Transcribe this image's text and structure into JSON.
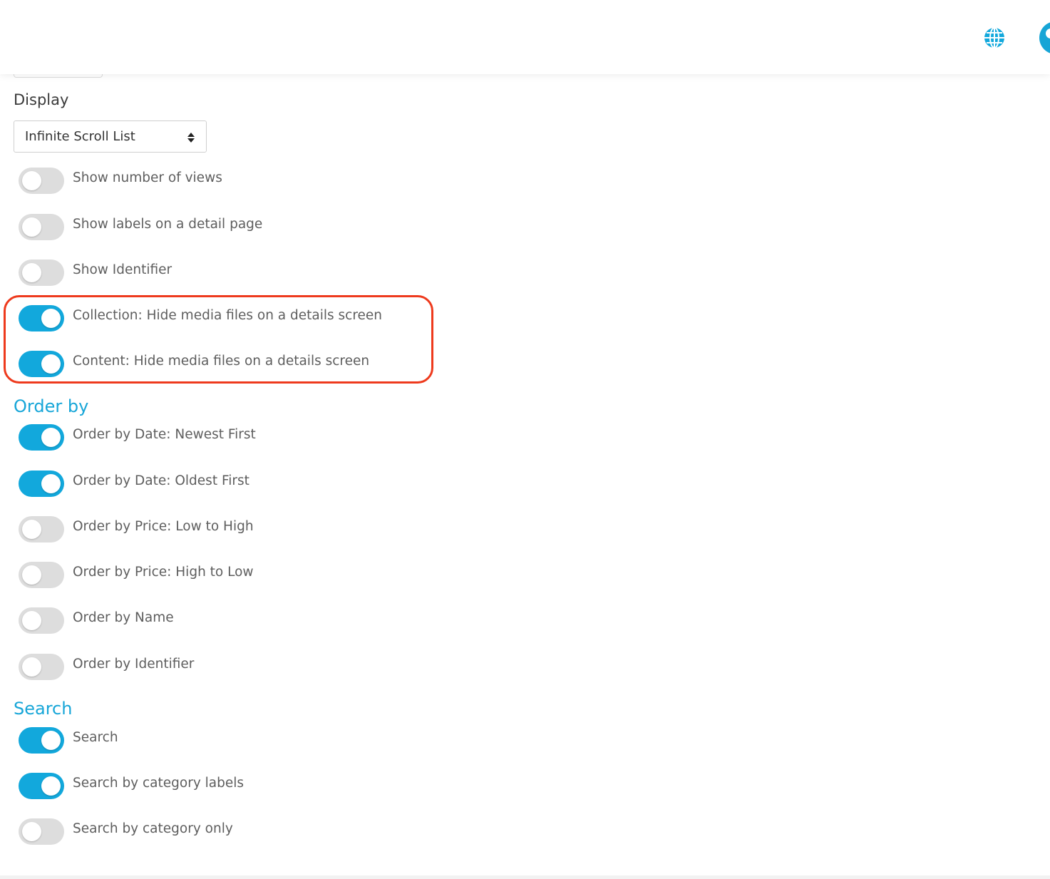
{
  "display": {
    "label": "Display",
    "select_value": "Infinite Scroll List"
  },
  "display_toggles": [
    {
      "label": "Show number of views",
      "on": false
    },
    {
      "label": "Show labels on a detail page",
      "on": false
    },
    {
      "label": "Show Identifier",
      "on": false
    },
    {
      "label": "Collection: Hide media files on a details screen",
      "on": true
    },
    {
      "label": "Content: Hide media files on a details screen",
      "on": true
    }
  ],
  "order_by": {
    "title": "Order by",
    "toggles": [
      {
        "label": "Order by Date: Newest First",
        "on": true
      },
      {
        "label": "Order by Date: Oldest First",
        "on": true
      },
      {
        "label": "Order by Price: Low to High",
        "on": false
      },
      {
        "label": "Order by Price: High to Low",
        "on": false
      },
      {
        "label": "Order by Name",
        "on": false
      },
      {
        "label": "Order by Identifier",
        "on": false
      }
    ]
  },
  "search": {
    "title": "Search",
    "toggles": [
      {
        "label": "Search",
        "on": true
      },
      {
        "label": "Search by category labels",
        "on": true
      },
      {
        "label": "Search by category only",
        "on": false
      }
    ]
  },
  "icons": {
    "header_left": "globe-icon",
    "header_right": "user-avatar-icon"
  },
  "colors": {
    "accent": "#12a8dc",
    "highlight": "#ee3a1d",
    "toggle_off": "#dddddd"
  }
}
